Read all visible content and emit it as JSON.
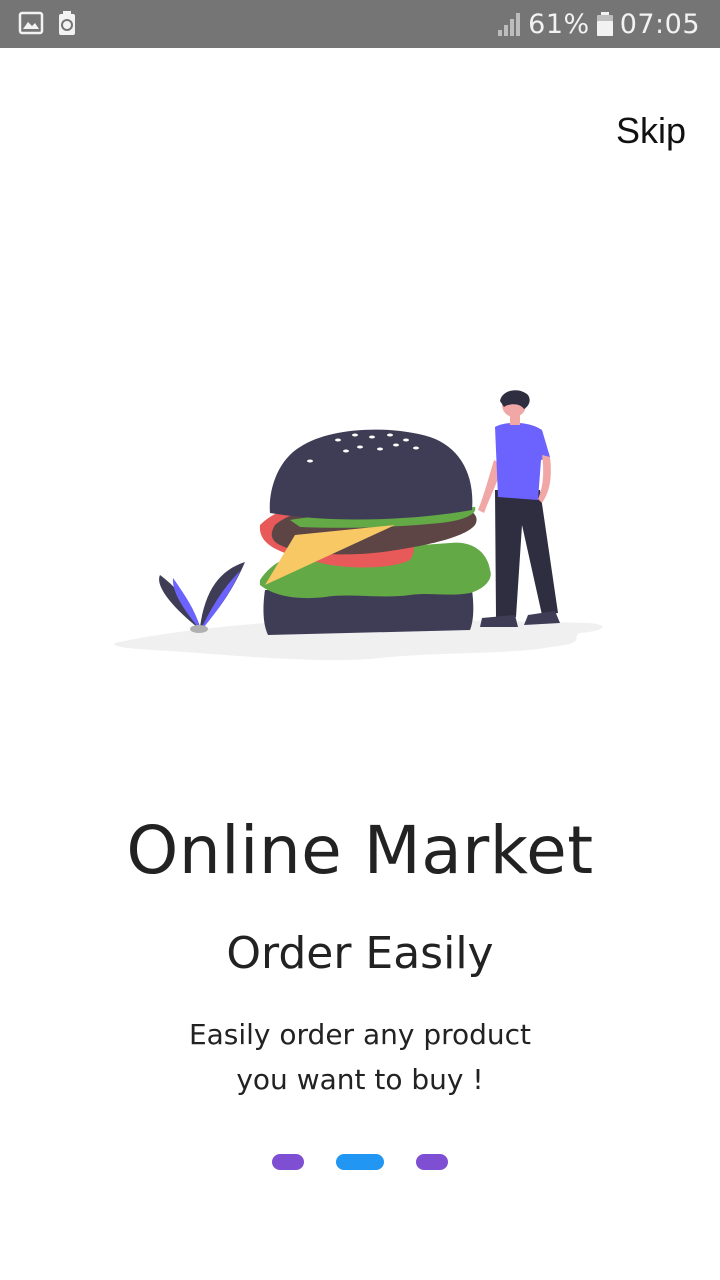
{
  "status_bar": {
    "left_icons": [
      "image-icon",
      "battery-recycle-icon"
    ],
    "signal_icon": "signal-icon",
    "battery_percent": "61%",
    "battery_icon": "battery-icon",
    "time": "07:05"
  },
  "header": {
    "skip_label": "Skip"
  },
  "illustration": {
    "icon": "burger-man-illustration",
    "colors": {
      "bun": "#3f3d56",
      "shirt": "#6c63ff",
      "lettuce": "#63a946",
      "cheese": "#f7c864",
      "tomato": "#e85a5a",
      "patty": "#5e4545",
      "skin": "#f2a7a7",
      "ground": "#f0f0f0"
    }
  },
  "content": {
    "title": "Online Market",
    "subtitle": "Order Easily",
    "description_line1": "Easily order any product",
    "description_line2": "you want to buy !"
  },
  "pager": {
    "count": 3,
    "active_index": 1,
    "colors": {
      "active": "#2196f3",
      "inactive": "#7e4fd3"
    }
  }
}
